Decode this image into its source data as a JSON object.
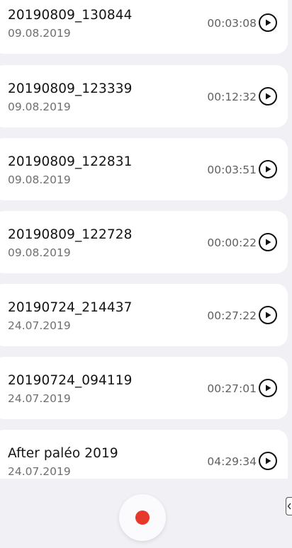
{
  "recordings": [
    {
      "name": "20190809_130844",
      "date": "09.08.2019",
      "duration": "00:03:08",
      "play_icon": "play-circle-icon"
    },
    {
      "name": "20190809_123339",
      "date": "09.08.2019",
      "duration": "00:12:32",
      "play_icon": "play-circle-icon"
    },
    {
      "name": "20190809_122831",
      "date": "09.08.2019",
      "duration": "00:03:51",
      "play_icon": "play-circle-icon"
    },
    {
      "name": "20190809_122728",
      "date": "09.08.2019",
      "duration": "00:00:22",
      "play_icon": "play-circle-icon"
    },
    {
      "name": "20190724_214437",
      "date": "24.07.2019",
      "duration": "00:27:22",
      "play_icon": "play-circle-icon"
    },
    {
      "name": "20190724_094119",
      "date": "24.07.2019",
      "duration": "00:27:01",
      "play_icon": "play-circle-icon"
    },
    {
      "name": "After paléo 2019",
      "date": "24.07.2019",
      "duration": "04:29:34",
      "play_icon": "play-circle-icon"
    }
  ],
  "record_button": {
    "icon": "record-dot-icon",
    "color": "#e6392b"
  },
  "side_panel_handle": {
    "icon": "chevron-left-icon"
  },
  "colors": {
    "background": "#f1f0f5",
    "card": "#ffffff",
    "record": "#e6392b"
  }
}
